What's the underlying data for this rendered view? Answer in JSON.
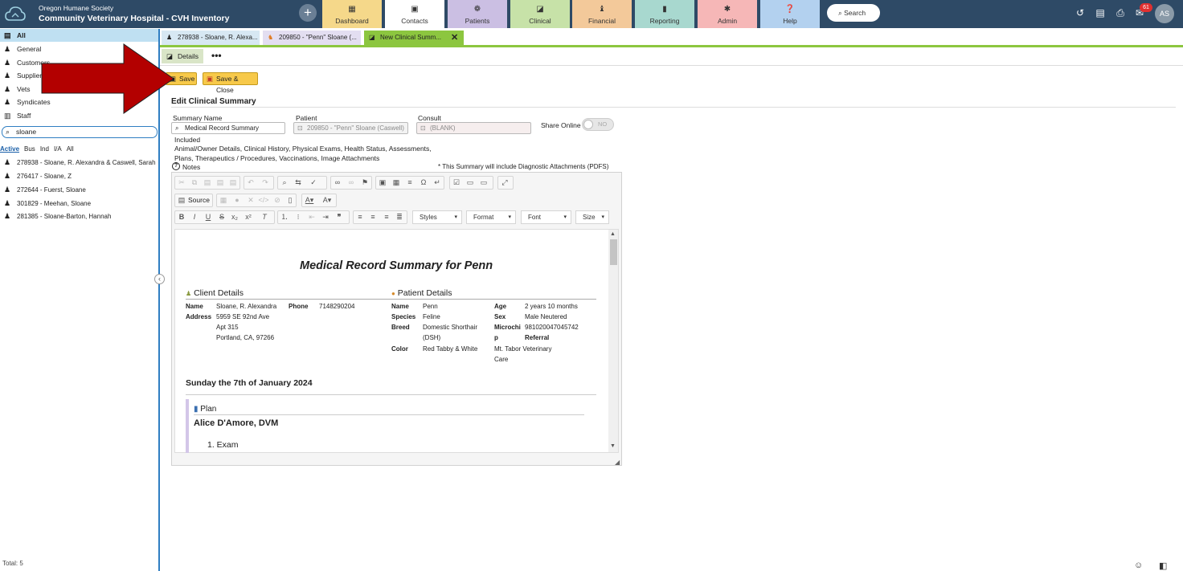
{
  "header": {
    "org": "Oregon Humane Society",
    "hospital": "Community Veterinary Hospital - CVH Inventory",
    "nav": [
      {
        "label": "Dashboard",
        "icon": "dashboard-icon",
        "glyph": "▦",
        "color": "#f5d88a"
      },
      {
        "label": "Contacts",
        "icon": "contacts-icon",
        "glyph": "▣",
        "color": "#ffffff"
      },
      {
        "label": "Patients",
        "icon": "paw-icon",
        "glyph": "❁",
        "color": "#cbbfe3"
      },
      {
        "label": "Clinical",
        "icon": "clinical-icon",
        "glyph": "◪",
        "color": "#c7e2a8"
      },
      {
        "label": "Financial",
        "icon": "financial-icon",
        "glyph": "♝",
        "color": "#f3c99a"
      },
      {
        "label": "Reporting",
        "icon": "reporting-icon",
        "glyph": "▮",
        "color": "#a8d8cf"
      },
      {
        "label": "Admin",
        "icon": "gear-icon",
        "glyph": "✱",
        "color": "#f6b7b7"
      },
      {
        "label": "Help",
        "icon": "help-icon",
        "glyph": "❓",
        "color": "#b3d1ef"
      }
    ],
    "search_label": "Search",
    "mail_count": "61",
    "avatar": "AS"
  },
  "sidebar": {
    "categories": [
      {
        "label": "All",
        "icon": "list-icon",
        "glyph": "▤",
        "selected": true
      },
      {
        "label": "General",
        "icon": "person-icon",
        "glyph": "♟"
      },
      {
        "label": "Customers",
        "icon": "customer-icon",
        "glyph": "♟"
      },
      {
        "label": "Suppliers",
        "icon": "supplier-icon",
        "glyph": "♟"
      },
      {
        "label": "Vets",
        "icon": "vet-icon",
        "glyph": "♟"
      },
      {
        "label": "Syndicates",
        "icon": "group-icon",
        "glyph": "♟"
      },
      {
        "label": "Staff",
        "icon": "staff-icon",
        "glyph": "▥"
      }
    ],
    "search_value": "sloane",
    "filters": [
      "Active",
      "Bus",
      "Ind",
      "I/A",
      "All"
    ],
    "results": [
      "278938 - Sloane, R. Alexandra & Caswell, Sarah",
      "276417 - Sloane, Z",
      "272644 - Fuerst, Sloane",
      "301829 - Meehan, Sloane",
      "281385 - Sloane-Barton, Hannah"
    ],
    "total": "Total: 5"
  },
  "doc_tabs": [
    {
      "label": "278938 - Sloane, R. Alexa..."
    },
    {
      "label": "209850 - \"Penn\" Sloane (..."
    },
    {
      "label": "New Clinical Summ..."
    }
  ],
  "toolbar": {
    "details_tab": "Details",
    "more": "•••",
    "save": "Save",
    "save_close": "Save & Close"
  },
  "form": {
    "title": "Edit Clinical Summary",
    "summary_name_label": "Summary Name",
    "summary_name_value": "Medical Record Summary",
    "patient_label": "Patient",
    "patient_value": "209850 - \"Penn\" Sloane (Caswell)",
    "consult_label": "Consult",
    "consult_value": "(BLANK)",
    "share_label": "Share Online",
    "share_value": "NO",
    "included_label": "Included",
    "included_text": "Animal/Owner Details, Clinical History, Physical Exams, Health Status, Assessments, Plans, Therapeutics / Procedures, Vaccinations, Image Attachments",
    "notes_label": "Notes",
    "diagnostic_note": "* This Summary will include Diagnostic Attachments (PDFS)"
  },
  "editor": {
    "source_label": "Source",
    "styles": "Styles",
    "format": "Format",
    "font": "Font",
    "size": "Size"
  },
  "document": {
    "title": "Medical Record Summary for Penn",
    "client_head": "Client Details",
    "patient_head": "Patient Details",
    "client": {
      "name_k": "Name",
      "name_v": "Sloane, R. Alexandra",
      "phone_k": "Phone",
      "phone_v": "7148290204",
      "address_k": "Address",
      "addr1": "5959 SE 92nd Ave",
      "addr2": "Apt 315",
      "addr3": "Portland, CA, 97266"
    },
    "patient": {
      "name_k": "Name",
      "name_v": "Penn",
      "species_k": "Species",
      "species_v": "Feline",
      "breed_k": "Breed",
      "breed_v1": "Domestic Shorthair",
      "breed_v2": "(DSH)",
      "color_k": "Color",
      "color_v": "Red Tabby & White",
      "age_k": "Age",
      "age_v": "2 years 10 months",
      "sex_k": "Sex",
      "sex_v": "Male Neutered",
      "micro_k1": "Microchi",
      "micro_k2": "p",
      "micro_v": "981020047045742",
      "referral_k": "Referral",
      "referral_v1": "Mt. Tabor Veterinary",
      "referral_v2": "Care"
    },
    "date_head": "Sunday the 7th of January 2024",
    "plan_head": "Plan",
    "vet": "Alice D'Amore, DVM",
    "exam": "1. Exam"
  }
}
